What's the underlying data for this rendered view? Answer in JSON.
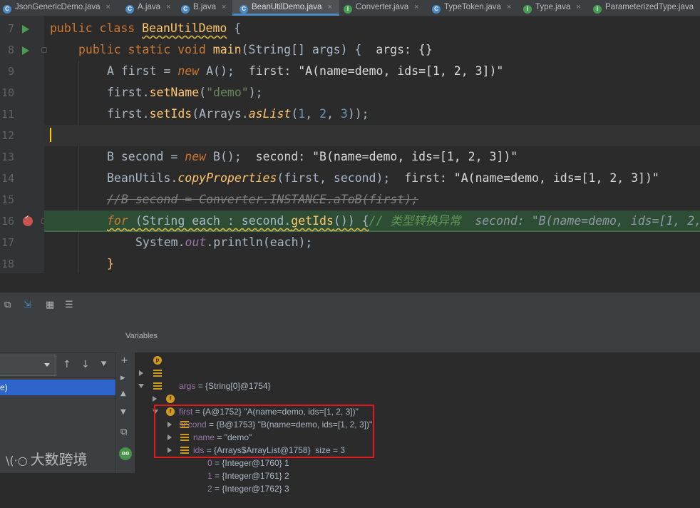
{
  "tabs": [
    {
      "label": "JsonGenericDemo.java",
      "color": "#4a88c7",
      "letter": "C",
      "active": false
    },
    {
      "label": "A.java",
      "color": "#4a88c7",
      "letter": "C",
      "active": false
    },
    {
      "label": "B.java",
      "color": "#4a88c7",
      "letter": "C",
      "active": false
    },
    {
      "label": "BeanUtilDemo.java",
      "color": "#4a88c7",
      "letter": "C",
      "active": true
    },
    {
      "label": "Converter.java",
      "color": "#499c54",
      "letter": "I",
      "active": false
    },
    {
      "label": "TypeToken.java",
      "color": "#4a88c7",
      "letter": "C",
      "active": false
    },
    {
      "label": "Type.java",
      "color": "#499c54",
      "letter": "I",
      "active": false
    },
    {
      "label": "ParameterizedType.java",
      "color": "#499c54",
      "letter": "I",
      "active": false
    }
  ],
  "tab_close": "×",
  "line_numbers": [
    "7",
    "8",
    "9",
    "10",
    "11",
    "12",
    "13",
    "14",
    "15",
    "16",
    "17",
    "18"
  ],
  "code": {
    "l7": {
      "kw1": "public",
      "kw2": "class",
      "name": "BeanUtilDemo",
      "rest": " {"
    },
    "l8": {
      "kw1": "public",
      "kw2": "static",
      "kw3": "void",
      "fn": "main",
      "params": "(String[] args) {",
      "hint": "  args: {}"
    },
    "l9": {
      "pre": "A first = ",
      "kw": "new",
      "post": " A();",
      "hint_label": "  first: ",
      "hint_val": "\"A(name=demo, ids=[1, 2, 3])\""
    },
    "l10": {
      "obj": "first.",
      "fn": "setName",
      "open": "(",
      "str": "\"demo\"",
      "close": ");"
    },
    "l11": {
      "obj": "first.",
      "fn": "setIds",
      "mid": "(Arrays.",
      "sfn": "asList",
      "open": "(",
      "n1": "1",
      ", ": ", ",
      "n2": "2",
      "n3": "3",
      "close": "));"
    },
    "l13": {
      "pre": "B second = ",
      "kw": "new",
      "post": " B();",
      "hint_label": "  second: ",
      "hint_val": "\"B(name=demo, ids=[1, 2, 3])\""
    },
    "l14": {
      "obj": "BeanUtils.",
      "sfn": "copyProperties",
      "args": "(first, second);",
      "hint_label": "  first: ",
      "hint_val": "\"A(name=demo, ids=[1, 2, 3])\""
    },
    "l15": {
      "comment": "//B second = Converter.INSTANCE.aToB(first);"
    },
    "l16": {
      "kw": "for",
      "mid": " (String each : second.",
      "fn": "getIds",
      "close": "()) {",
      "comment": "// 类型转换异常",
      "hint": "  second: \"B(name=demo, ids=[1, 2,"
    },
    "l17": {
      "pre": "System.",
      "sf": "out",
      "mid": ".println(each);"
    },
    "l18": {
      "brace": "}"
    }
  },
  "debug_toolbar": {
    "restore_layout": "⧉",
    "cursor_btn": "⇲",
    "table_btn": "▦",
    "settings_btn": "☰"
  },
  "variables_title": "Variables",
  "frames": {
    "selected_label": "e)",
    "up": "↑",
    "down": "↓",
    "filter": "⯆"
  },
  "side_buttons": {
    "add": "+",
    "expand": "▸",
    "up": "▲",
    "down": "▼",
    "copy": "⧉",
    "watch": "oo"
  },
  "variables": [
    {
      "indent": 0,
      "arrow": "none",
      "icon": "p",
      "name": "args",
      "val": " = {String[0]@1754}",
      "str": ""
    },
    {
      "indent": 0,
      "arrow": "right",
      "icon": "stk",
      "name": "first",
      "val": " = {A@1752} ",
      "str": "\"A(name=demo, ids=[1, 2, 3])\""
    },
    {
      "indent": 0,
      "arrow": "down",
      "icon": "stk",
      "name": "second",
      "val": " = {B@1753} ",
      "str": "\"B(name=demo, ids=[1, 2, 3])\""
    },
    {
      "indent": 1,
      "arrow": "right",
      "icon": "f",
      "name": "name",
      "val": " = ",
      "str": "\"demo\""
    },
    {
      "indent": 1,
      "arrow": "down",
      "icon": "f",
      "name": "ids",
      "val": " = {Arrays$ArrayList@1758}  size = 3",
      "str": ""
    },
    {
      "indent": 2,
      "arrow": "right",
      "icon": "stk",
      "name": "0",
      "val": " = {Integer@1760} 1",
      "str": ""
    },
    {
      "indent": 2,
      "arrow": "right",
      "icon": "stk",
      "name": "1",
      "val": " = {Integer@1761} 2",
      "str": ""
    },
    {
      "indent": 2,
      "arrow": "right",
      "icon": "stk",
      "name": "2",
      "val": " = {Integer@1762} 3",
      "str": ""
    }
  ],
  "watermark": "大数跨境",
  "watermark_logo": "\\(·○"
}
